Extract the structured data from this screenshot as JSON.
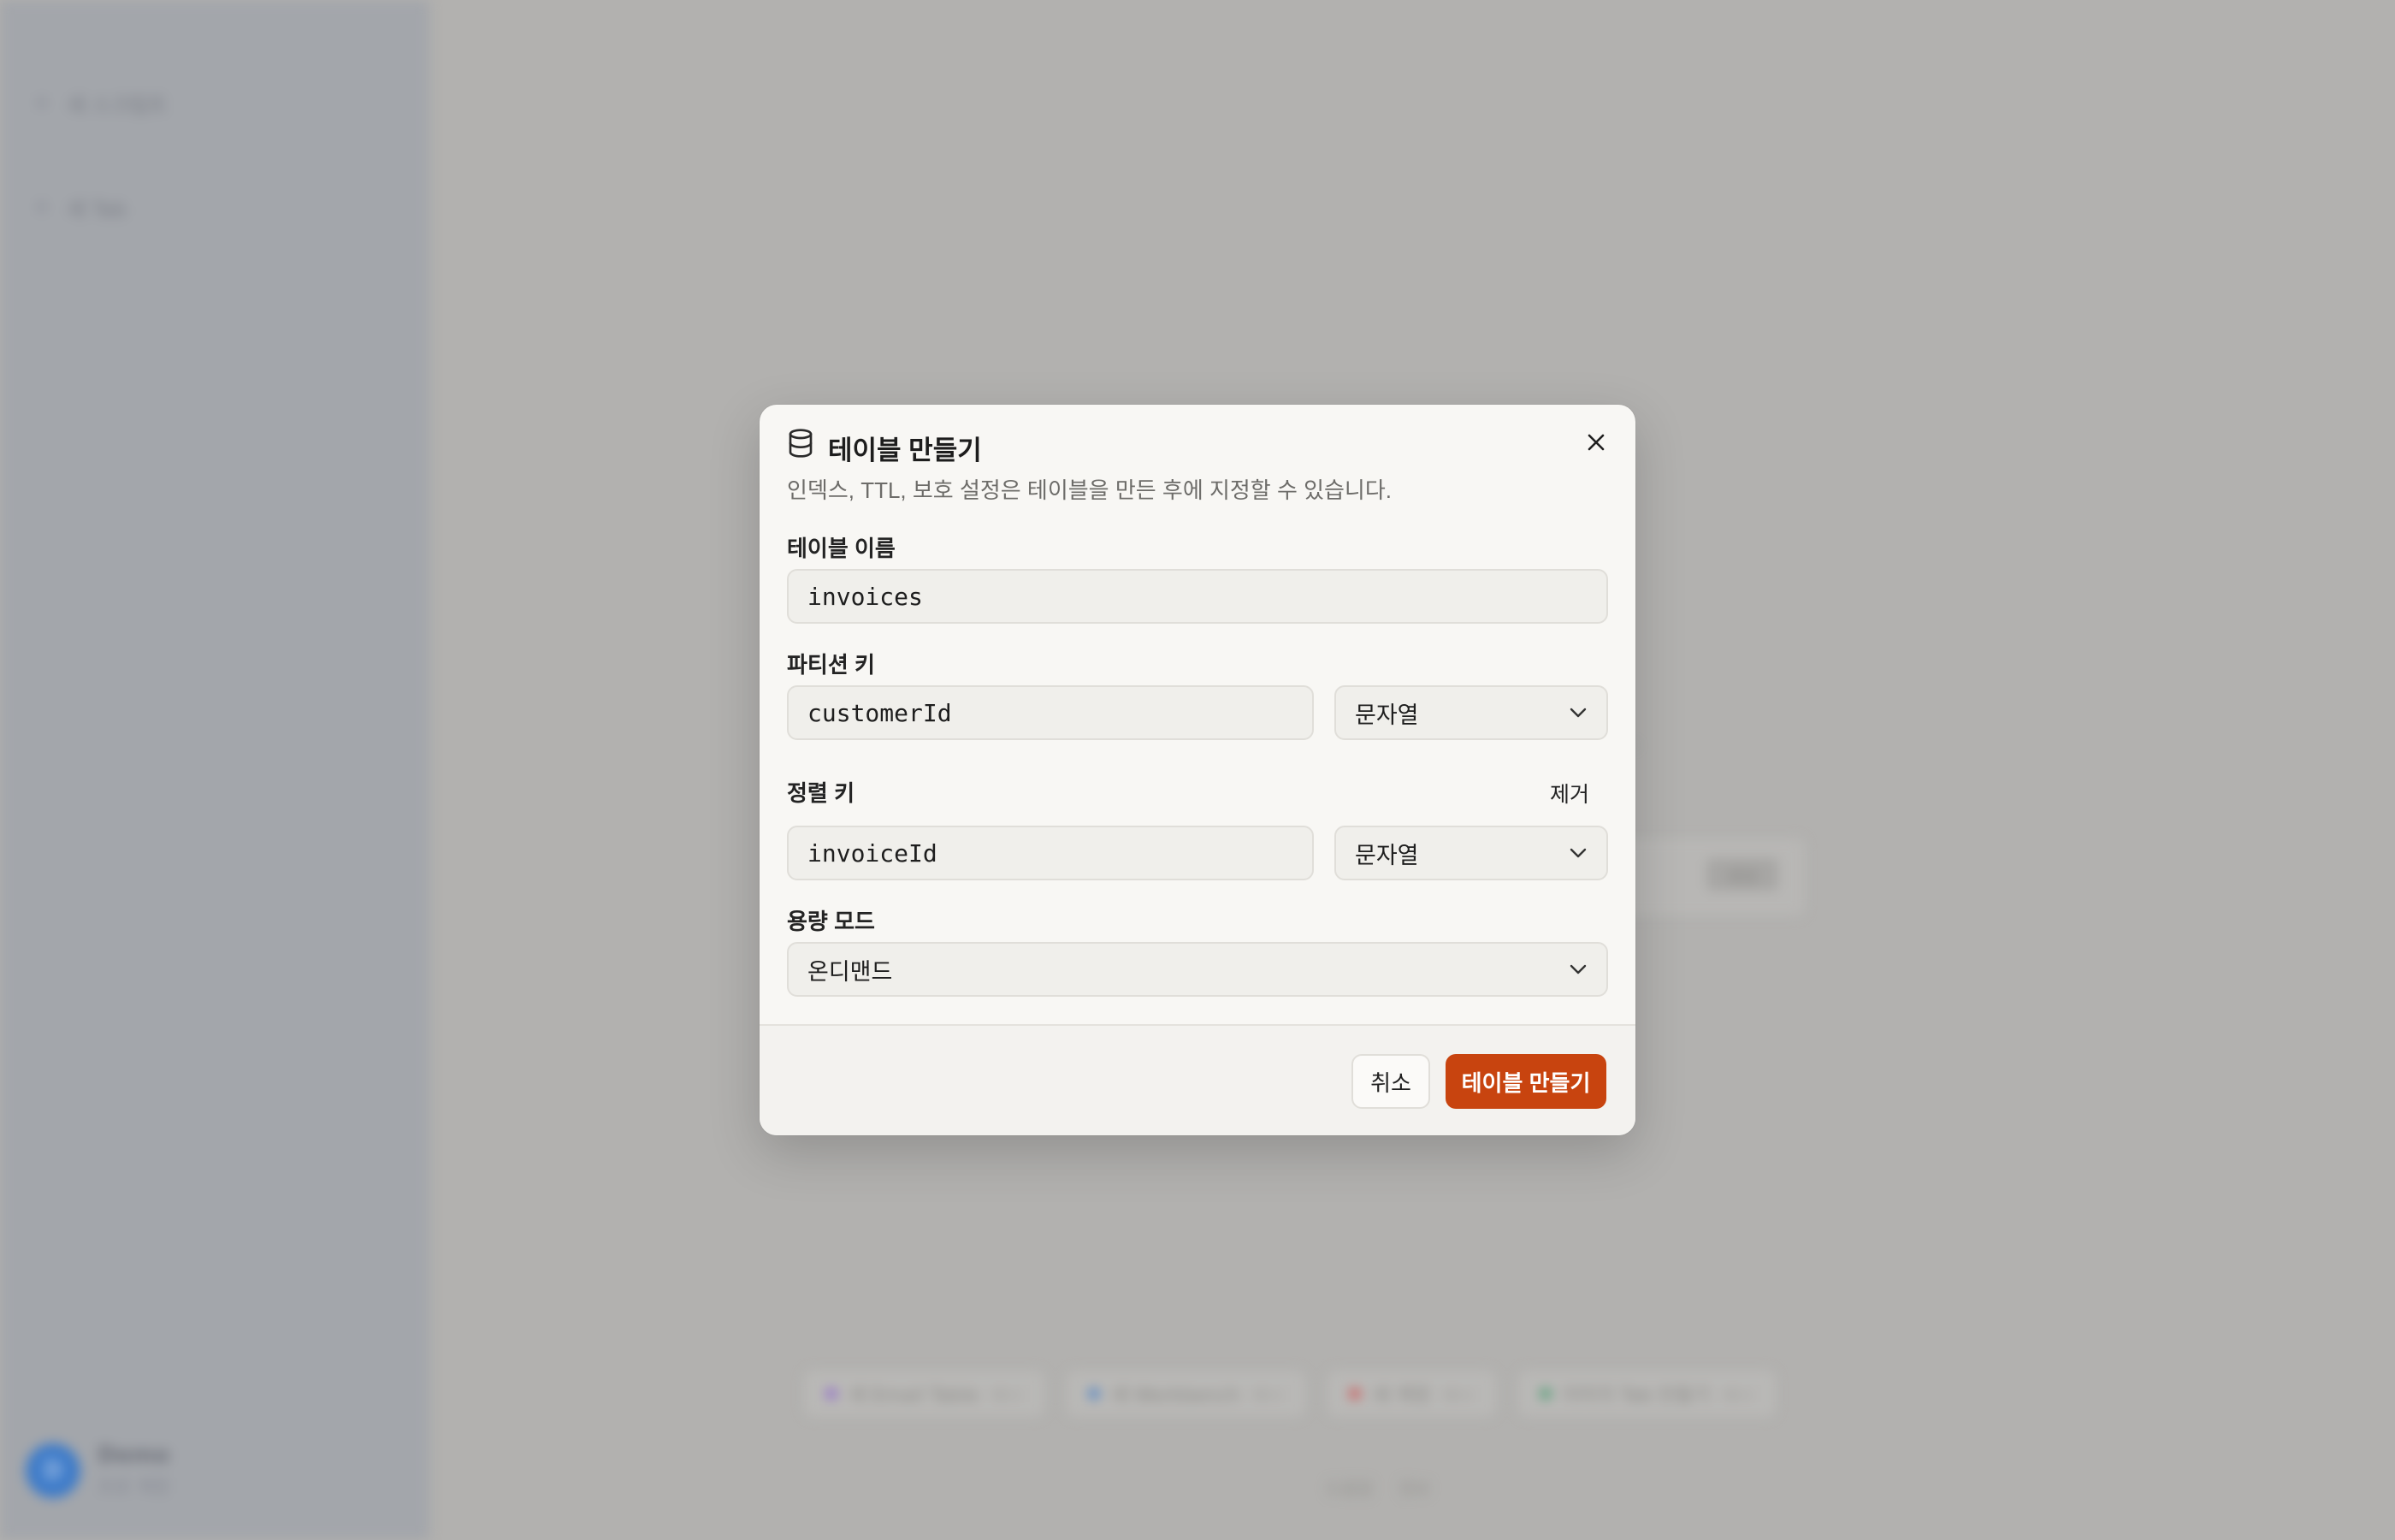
{
  "background": {
    "sidebar": {
      "items": [
        {
          "icon": "plus-icon",
          "label": "새 스크립트"
        },
        {
          "icon": "plus-icon",
          "label": "새 Tab"
        }
      ],
      "user": {
        "avatar": "D",
        "name": "Demo",
        "subtitle": "프로 계정"
      }
    },
    "main": {
      "hint_text": "…",
      "button_label": "생성",
      "pills": [
        {
          "label": "새 Email Table",
          "meta": "예시",
          "color": "#8a5fd0"
        },
        {
          "label": "새 Workbench",
          "meta": "예시",
          "color": "#3f7cc9"
        },
        {
          "label": "새 계정",
          "meta": "예시",
          "color": "#d24a4a"
        },
        {
          "label": "이미지 Tab 만들기",
          "meta": "예시",
          "color": "#3f9a6a"
        }
      ],
      "footer": [
        "도움말",
        "정보"
      ]
    }
  },
  "modal": {
    "title": "테이블 만들기",
    "description": "인덱스, TTL, 보호 설정은 테이블을 만든 후에 지정할 수 있습니다.",
    "table_name": {
      "label": "테이블 이름",
      "value": "invoices"
    },
    "partition_key": {
      "label": "파티션 키",
      "value": "customerId",
      "type": "문자열"
    },
    "sort_key": {
      "label": "정렬 키",
      "value": "invoiceId",
      "type": "문자열",
      "remove_label": "제거"
    },
    "capacity_mode": {
      "label": "용량 모드",
      "value": "온디맨드"
    },
    "cancel_label": "취소",
    "create_label": "테이블 만들기",
    "accent_color": "#c8440f"
  }
}
